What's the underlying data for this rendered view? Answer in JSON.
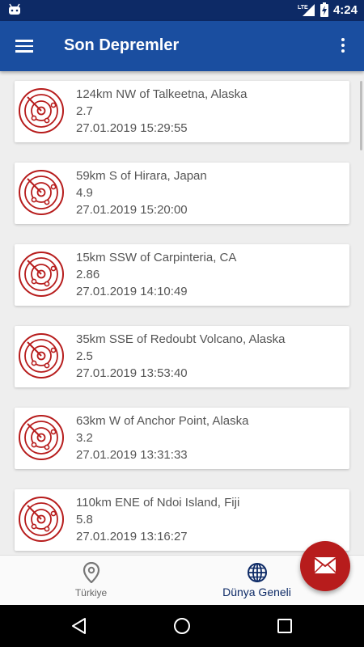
{
  "status_bar": {
    "time": "4:24",
    "network": "LTE",
    "battery_glyph": "battery-charging-icon"
  },
  "app_bar": {
    "title": "Son Depremler"
  },
  "earthquakes": [
    {
      "place": "124km NW of Talkeetna, Alaska",
      "magnitude": "2.7",
      "datetime": "27.01.2019 15:29:55"
    },
    {
      "place": "59km S of Hirara, Japan",
      "magnitude": "4.9",
      "datetime": "27.01.2019 15:20:00"
    },
    {
      "place": "15km SSW of Carpinteria, CA",
      "magnitude": "2.86",
      "datetime": "27.01.2019 14:10:49"
    },
    {
      "place": "35km SSE of Redoubt Volcano, Alaska",
      "magnitude": "2.5",
      "datetime": "27.01.2019 13:53:40"
    },
    {
      "place": "63km W of Anchor Point, Alaska",
      "magnitude": "3.2",
      "datetime": "27.01.2019 13:31:33"
    },
    {
      "place": "110km ENE of Ndoi Island, Fiji",
      "magnitude": "5.8",
      "datetime": "27.01.2019 13:16:27"
    }
  ],
  "bottom_nav": {
    "items": [
      {
        "label": "Türkiye",
        "icon": "location-pin-icon",
        "active": false
      },
      {
        "label": "Dünya Geneli",
        "icon": "globe-icon",
        "active": true
      }
    ]
  },
  "colors": {
    "primary": "#1a4ea0",
    "primary_dark": "#0d2a66",
    "accent": "#b71c1c",
    "radar": "#b71c1c"
  }
}
